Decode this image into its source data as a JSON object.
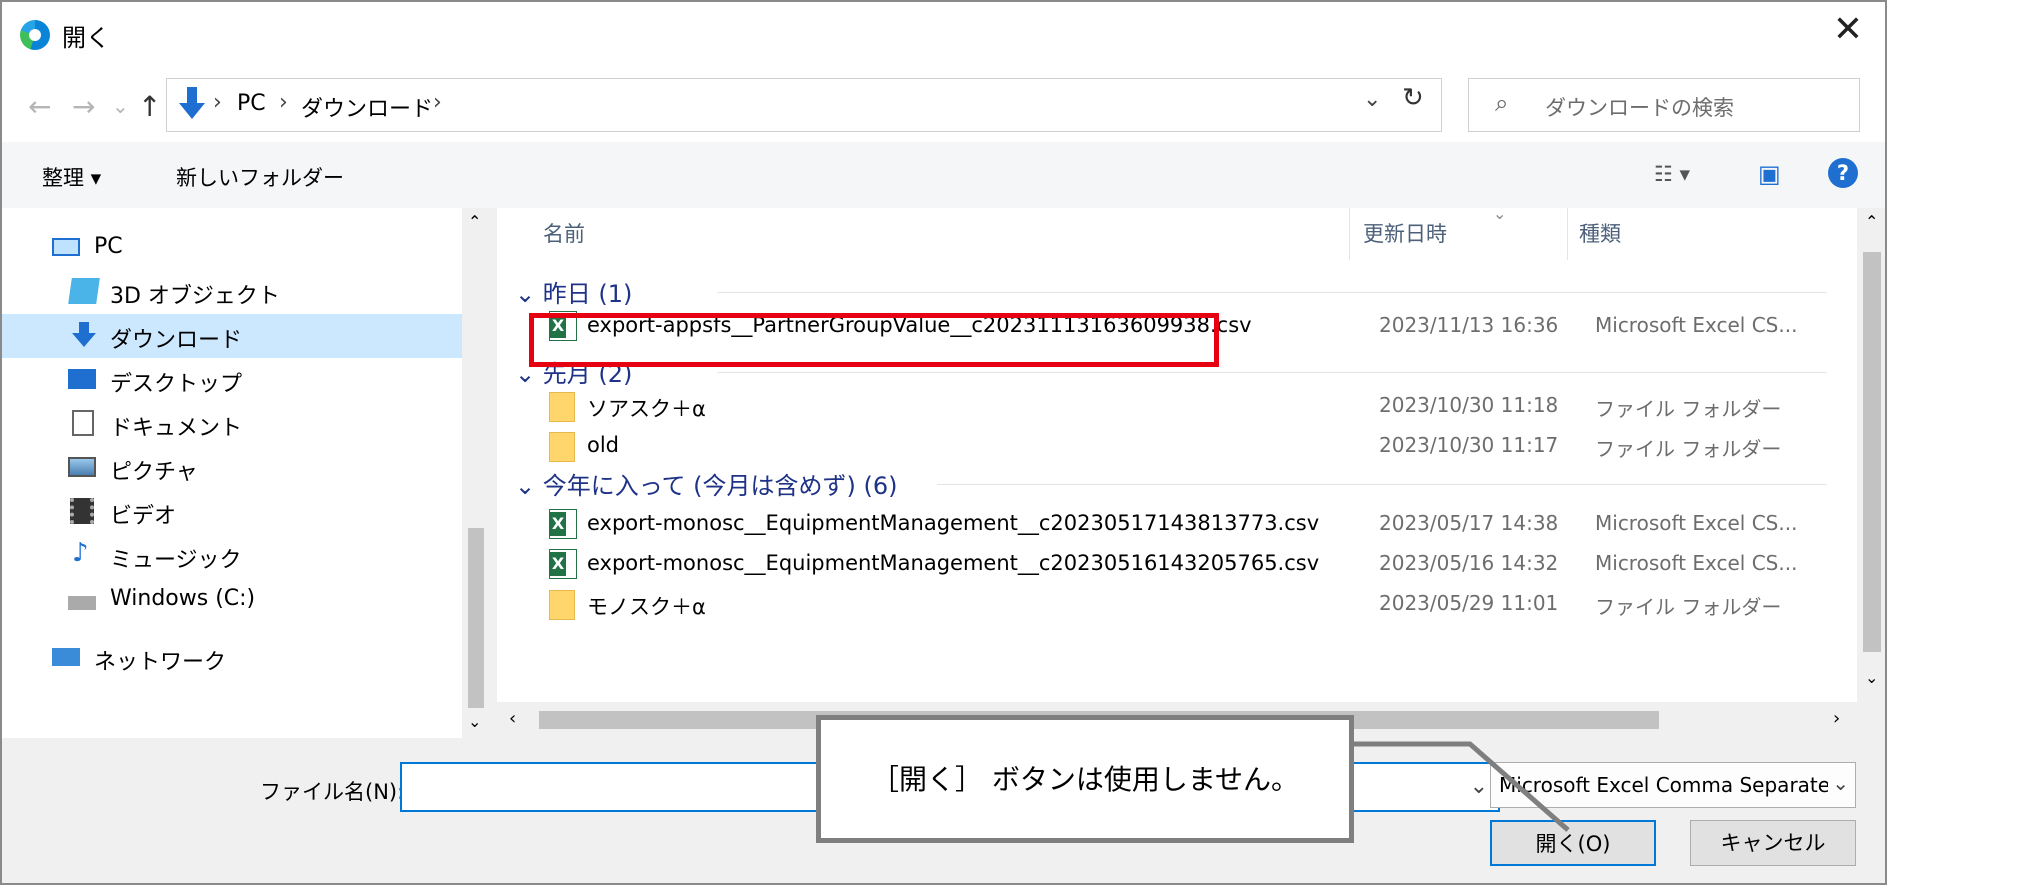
{
  "window": {
    "title": "開く",
    "close_glyph": "✕"
  },
  "nav": {
    "back": "←",
    "forward": "→",
    "history": "⌄",
    "up": "↑",
    "address": [
      "PC",
      "ダウンロード"
    ],
    "separator": "›",
    "dropdown": "⌄",
    "refresh": "↻",
    "search_placeholder": "ダウンロードの検索"
  },
  "toolbar": {
    "organize": "整理 ▾",
    "new_folder": "新しいフォルダー",
    "view_glyph": "☷ ▾",
    "preview_glyph": "▣",
    "help": "?"
  },
  "sidebar": {
    "items": [
      {
        "label": "PC",
        "icon": "pc-icon"
      },
      {
        "label": "3D オブジェクト",
        "icon": "3d-objects-icon"
      },
      {
        "label": "ダウンロード",
        "icon": "download-icon",
        "selected": true
      },
      {
        "label": "デスクトップ",
        "icon": "desktop-icon"
      },
      {
        "label": "ドキュメント",
        "icon": "documents-icon"
      },
      {
        "label": "ピクチャ",
        "icon": "pictures-icon"
      },
      {
        "label": "ビデオ",
        "icon": "videos-icon"
      },
      {
        "label": "ミュージック",
        "icon": "music-icon"
      },
      {
        "label": "Windows (C:)",
        "icon": "drive-icon"
      },
      {
        "label": "ネットワーク",
        "icon": "network-icon"
      }
    ]
  },
  "columns": {
    "name": "名前",
    "modified": "更新日時",
    "type": "種類"
  },
  "groups": [
    {
      "label": "昨日 (1)",
      "files": [
        {
          "name": "export-appsfs__PartnerGroupValue__c20231113163609938.csv",
          "date": "2023/11/13 16:36",
          "type": "Microsoft Excel CS...",
          "kind": "excel"
        }
      ]
    },
    {
      "label": "先月 (2)",
      "files": [
        {
          "name": "ソアスク＋α",
          "date": "2023/10/30 11:18",
          "type": "ファイル フォルダー",
          "kind": "folder"
        },
        {
          "name": "old",
          "date": "2023/10/30 11:17",
          "type": "ファイル フォルダー",
          "kind": "folder"
        }
      ]
    },
    {
      "label": "今年に入って (今月は含めず) (6)",
      "files": [
        {
          "name": "export-monosc__EquipmentManagement__c20230517143813773.csv",
          "date": "2023/05/17 14:38",
          "type": "Microsoft Excel CS...",
          "kind": "excel"
        },
        {
          "name": "export-monosc__EquipmentManagement__c20230516143205765.csv",
          "date": "2023/05/16 14:32",
          "type": "Microsoft Excel CS...",
          "kind": "excel"
        },
        {
          "name": "モノスク＋α",
          "date": "2023/05/29 11:01",
          "type": "ファイル フォルダー",
          "kind": "folder"
        }
      ]
    }
  ],
  "bottom": {
    "filename_label": "ファイル名(N):",
    "filename_value": "",
    "filetype": "Microsoft Excel Comma Separated",
    "open_button": "開く(O)",
    "cancel_button": "キャンセル"
  },
  "annotation": {
    "callout_text": "［開く］ ボタンは使用しません。",
    "highlight_color": "#e60012"
  }
}
